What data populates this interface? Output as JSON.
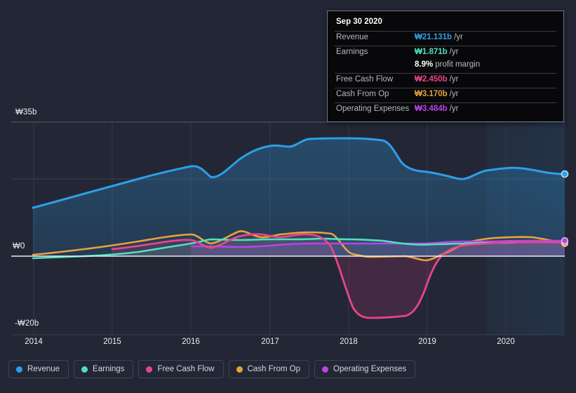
{
  "axes": {
    "y_top_label": "₩35b",
    "y_zero_label": "₩0",
    "y_bottom_label": "-₩20b",
    "x_labels": [
      "2014",
      "2015",
      "2016",
      "2017",
      "2018",
      "2019",
      "2020"
    ]
  },
  "tooltip": {
    "date": "Sep 30 2020",
    "rows": [
      {
        "label": "Revenue",
        "value": "₩21.131b",
        "suffix": "/yr",
        "color": "#2d9fe8"
      },
      {
        "label": "Earnings",
        "value": "₩1.871b",
        "suffix": "/yr",
        "color": "#4fe0c0"
      },
      {
        "label": "Free Cash Flow",
        "value": "₩2.450b",
        "suffix": "/yr",
        "color": "#e8458b"
      },
      {
        "label": "Cash From Op",
        "value": "₩3.170b",
        "suffix": "/yr",
        "color": "#e8a33d"
      },
      {
        "label": "Operating Expenses",
        "value": "₩3.484b",
        "suffix": "/yr",
        "color": "#b844e8"
      }
    ],
    "profit_margin_value": "8.9%",
    "profit_margin_label": "profit margin"
  },
  "legend": {
    "items": [
      {
        "label": "Revenue",
        "color": "#2d9fe8"
      },
      {
        "label": "Earnings",
        "color": "#4fe0c0"
      },
      {
        "label": "Free Cash Flow",
        "color": "#e8458b"
      },
      {
        "label": "Cash From Op",
        "color": "#e8a33d"
      },
      {
        "label": "Operating Expenses",
        "color": "#b844e8"
      }
    ]
  },
  "chart_data": {
    "type": "area",
    "title": "",
    "xlabel": "",
    "ylabel": "",
    "ylim": [
      -20,
      35
    ],
    "xlim": [
      "2014",
      "2020.75"
    ],
    "grid": true,
    "legend_position": "bottom",
    "currency": "KRW (₩), billions",
    "x": [
      2014.0,
      2014.25,
      2014.5,
      2014.75,
      2015.0,
      2015.25,
      2015.5,
      2015.75,
      2016.0,
      2016.25,
      2016.5,
      2016.75,
      2017.0,
      2017.25,
      2017.5,
      2017.75,
      2018.0,
      2018.25,
      2018.5,
      2018.75,
      2019.0,
      2019.25,
      2019.5,
      2019.75,
      2020.0,
      2020.25,
      2020.5,
      2020.75
    ],
    "series": [
      {
        "name": "Revenue",
        "color": "#2d9fe8",
        "values": [
          12.6,
          13.6,
          14.6,
          15.5,
          16.4,
          17.4,
          18.3,
          19.2,
          20.2,
          18.4,
          20.6,
          22.8,
          24.3,
          24.0,
          25.6,
          26.0,
          26.0,
          25.9,
          25.8,
          23.6,
          21.7,
          21.2,
          21.8,
          21.5,
          21.2,
          22.0,
          21.8,
          21.131
        ]
      },
      {
        "name": "Earnings",
        "color": "#4fe0c0",
        "values": [
          -0.6,
          -0.5,
          -0.4,
          -0.3,
          -0.1,
          0.2,
          0.5,
          0.9,
          1.3,
          1.6,
          2.1,
          2.4,
          2.2,
          2.4,
          2.3,
          2.2,
          2.3,
          2.2,
          2.1,
          1.6,
          1.3,
          1.4,
          1.6,
          1.7,
          1.8,
          1.9,
          1.9,
          1.871
        ]
      },
      {
        "name": "Free Cash Flow",
        "color": "#e8458b",
        "values": [
          null,
          null,
          null,
          null,
          0.4,
          0.7,
          1.0,
          1.2,
          1.6,
          0.9,
          1.9,
          2.6,
          2.1,
          2.3,
          2.7,
          2.6,
          1.2,
          -9.5,
          -16.0,
          -15.9,
          -15.4,
          -8.0,
          0.6,
          1.9,
          2.1,
          2.3,
          2.4,
          2.45
        ]
      },
      {
        "name": "Cash From Op",
        "color": "#e8a33d",
        "values": [
          0.4,
          0.6,
          0.8,
          1.0,
          1.3,
          1.5,
          1.8,
          2.0,
          2.4,
          1.5,
          2.6,
          3.4,
          2.7,
          2.9,
          3.3,
          3.2,
          3.1,
          0.7,
          -0.4,
          -0.5,
          -0.2,
          -1.0,
          0.8,
          2.7,
          3.0,
          3.4,
          3.5,
          3.17
        ]
      },
      {
        "name": "Operating Expenses",
        "color": "#b844e8",
        "values": [
          null,
          null,
          null,
          null,
          null,
          null,
          null,
          null,
          2.6,
          2.6,
          2.5,
          2.4,
          2.5,
          2.8,
          3.0,
          3.0,
          3.0,
          3.0,
          3.0,
          3.0,
          3.0,
          3.1,
          3.3,
          3.4,
          3.5,
          3.5,
          3.5,
          3.484
        ]
      }
    ]
  }
}
